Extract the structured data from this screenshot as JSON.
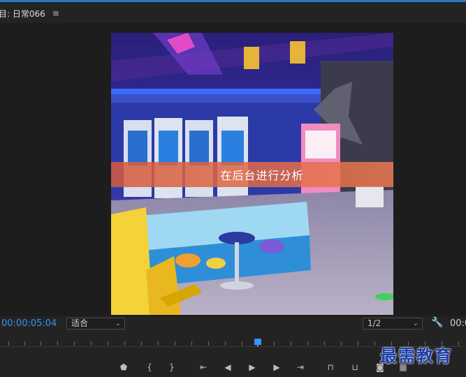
{
  "panel": {
    "title": "目: 日常066",
    "menu_icon": "hamburger-menu-icon"
  },
  "video": {
    "subtitle": "在后台进行分析"
  },
  "controls": {
    "timecode": "00:00:05:04",
    "fit_value": "适合",
    "resolution_value": "1/2",
    "settings_icon": "wrench-icon",
    "timecode_right": "00:0"
  },
  "transport": {
    "buttons": [
      "add-marker-icon",
      "mark-in-icon",
      "mark-out-icon",
      "go-to-in-icon",
      "step-back-icon",
      "play-icon",
      "step-forward-icon",
      "go-to-out-icon",
      "lift-icon",
      "extract-icon",
      "export-frame-icon",
      "compare-icon"
    ]
  },
  "watermark": {
    "text": "最需教育"
  },
  "colors": {
    "accent": "#3a92f5",
    "background": "#232323"
  }
}
